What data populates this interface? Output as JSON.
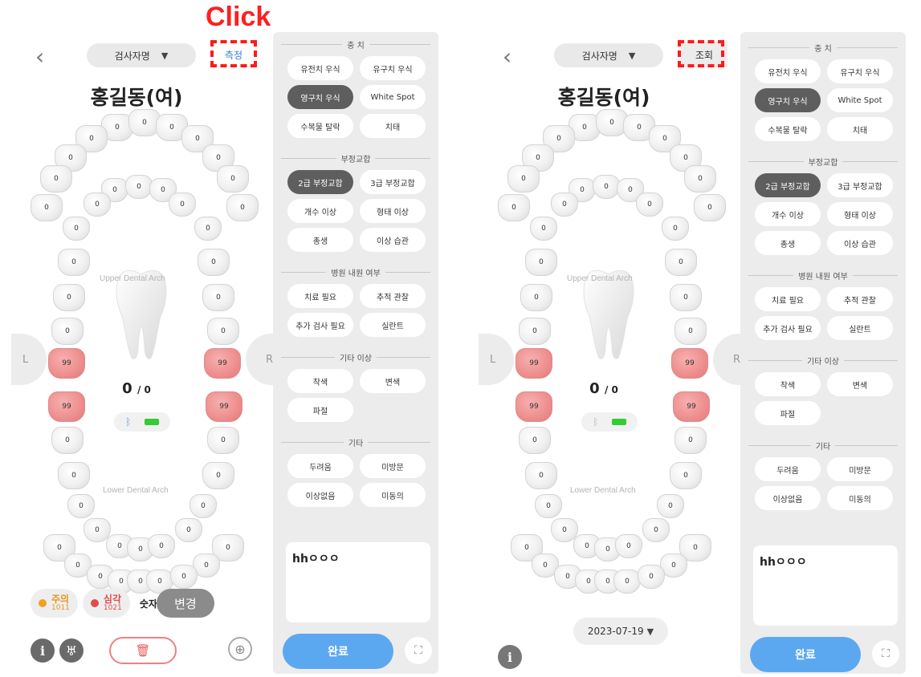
{
  "annotation": {
    "click_label": "Click"
  },
  "screens": [
    {
      "back_icon": "chevron-left-icon",
      "exam_select": {
        "label": "검사자명",
        "arrow": "▼"
      },
      "top_button": "측정",
      "patient_name": "홍길동(여)",
      "upper_label": "Upper Dental Arch",
      "lower_label": "Lower Dental Arch",
      "score_main": "0",
      "score_sub": "/ 0",
      "side_left": "L",
      "side_right": "R",
      "legend": [
        {
          "label": "주의",
          "count": "1011",
          "color": "#f0a21e"
        },
        {
          "label": "심각",
          "count": "1021",
          "color": "#e24b4b"
        }
      ],
      "number_only": "숫자만",
      "change_button": "변경",
      "bottom_icons": [
        "info-icon",
        "tooth-icon",
        "trash-icon",
        "target-icon"
      ]
    },
    {
      "back_icon": "chevron-left-icon",
      "exam_select": {
        "label": "검사자명",
        "arrow": "▼"
      },
      "top_button": "조회",
      "patient_name": "홍길동(여)",
      "upper_label": "Upper Dental Arch",
      "lower_label": "Lower Dental Arch",
      "score_main": "0",
      "score_sub": "/ 0",
      "side_left": "L",
      "side_right": "R",
      "date_select": {
        "value": "2023-07-19",
        "arrow": "▼"
      },
      "bottom_icons": [
        "info-icon"
      ]
    }
  ],
  "teeth_values": [
    "0",
    "99"
  ],
  "options": {
    "caries": {
      "title": "충 치",
      "items": [
        {
          "label": "유전치 우식",
          "selected": false
        },
        {
          "label": "유구치 우식",
          "selected": false
        },
        {
          "label": "영구치 우식",
          "selected": true
        },
        {
          "label": "White Spot",
          "selected": false
        },
        {
          "label": "수복물 탈락",
          "selected": false
        },
        {
          "label": "치태",
          "selected": false
        }
      ]
    },
    "malocclusion": {
      "title": "부정교합",
      "items": [
        {
          "label": "2급 부정교합",
          "selected": true
        },
        {
          "label": "3급 부정교합",
          "selected": false
        },
        {
          "label": "개수 이상",
          "selected": false
        },
        {
          "label": "형태 이상",
          "selected": false
        },
        {
          "label": "총생",
          "selected": false
        },
        {
          "label": "이상 습관",
          "selected": false
        }
      ]
    },
    "visit": {
      "title": "병원 내원 여부",
      "items": [
        {
          "label": "치료 필요",
          "selected": false
        },
        {
          "label": "추적 관찰",
          "selected": false
        },
        {
          "label": "추가 검사 필요",
          "selected": false
        },
        {
          "label": "실란트",
          "selected": false
        }
      ]
    },
    "other_abn": {
      "title": "기타 이상",
      "items": [
        {
          "label": "착색",
          "selected": false
        },
        {
          "label": "변색",
          "selected": false
        },
        {
          "label": "파절",
          "selected": false
        }
      ]
    },
    "etc": {
      "title": "기타",
      "items": [
        {
          "label": "두려움",
          "selected": false
        },
        {
          "label": "미방문",
          "selected": false
        },
        {
          "label": "이상없음",
          "selected": false
        },
        {
          "label": "미동의",
          "selected": false
        }
      ]
    }
  },
  "memo_text": "hhㅇㅇㅇ",
  "done_button": "완료",
  "scan_icon": "scan-icon"
}
